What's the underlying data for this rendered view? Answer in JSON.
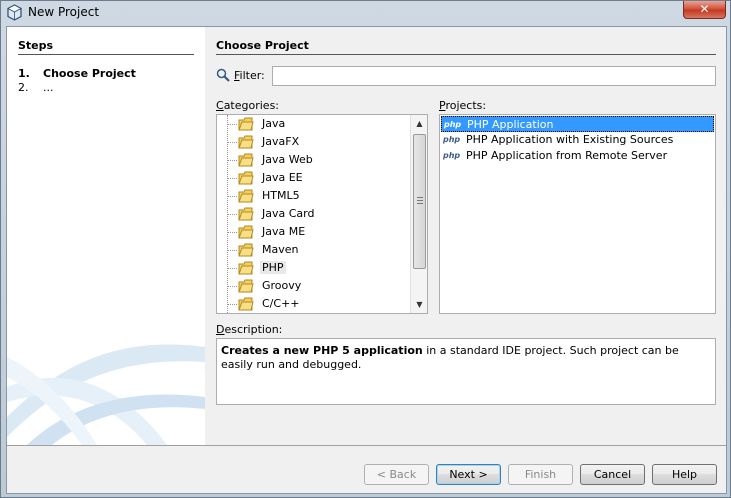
{
  "window": {
    "title": "New Project",
    "close_glyph": "✕"
  },
  "steps": {
    "title": "Steps",
    "items": [
      {
        "num": "1.",
        "label": "Choose Project"
      },
      {
        "num": "2.",
        "label": "..."
      }
    ]
  },
  "main": {
    "title": "Choose Project",
    "filter": {
      "label": "Filter:",
      "value": "",
      "placeholder": ""
    },
    "categories_label": "Categories:",
    "projects_label": "Projects:",
    "categories": [
      "Java",
      "JavaFX",
      "Java Web",
      "Java EE",
      "HTML5",
      "Java Card",
      "Java ME",
      "Maven",
      "PHP",
      "Groovy",
      "C/C++"
    ],
    "selected_category": "PHP",
    "projects": [
      {
        "icon": "php",
        "label": "PHP Application"
      },
      {
        "icon": "php",
        "label": "PHP Application with Existing Sources"
      },
      {
        "icon": "php",
        "label": "PHP Application from Remote Server"
      }
    ],
    "selected_project": "PHP Application",
    "description_label": "Description:",
    "description_bold": "Creates a new PHP 5 application",
    "description_rest": " in a standard IDE project. Such project can be easily run and debugged."
  },
  "buttons": {
    "back": "< Back",
    "next": "Next >",
    "finish": "Finish",
    "cancel": "Cancel",
    "help": "Help"
  },
  "icons": {
    "filter": "magnifier-icon",
    "category": "folder-icon",
    "project": "php-icon"
  },
  "colors": {
    "selection": "#3399ff",
    "close": "#c23a21"
  }
}
